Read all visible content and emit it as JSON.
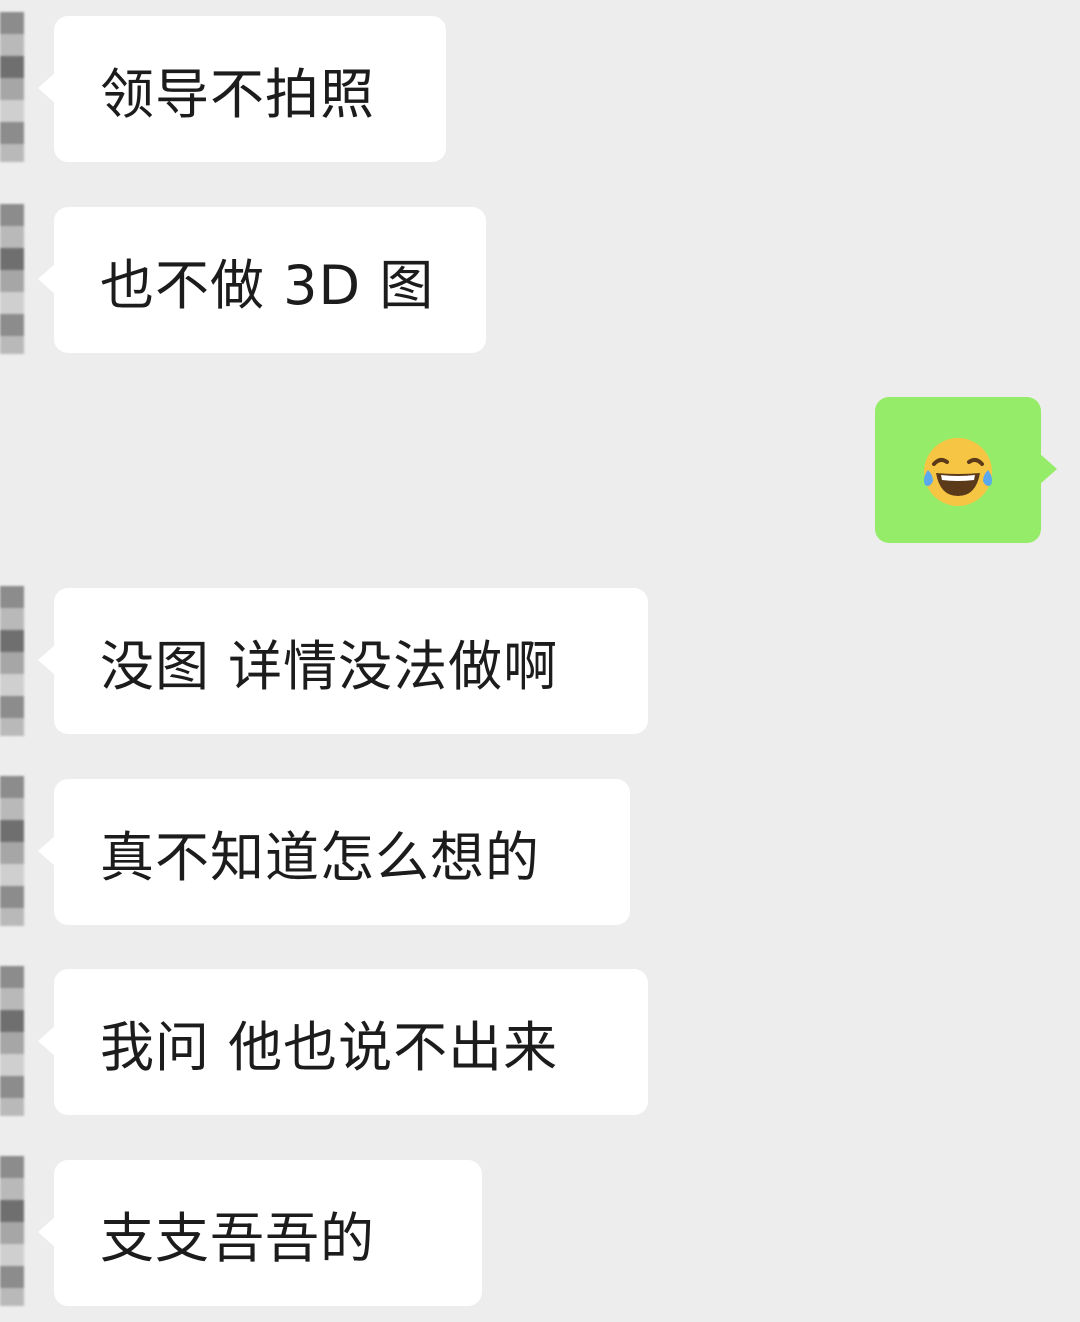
{
  "messages": [
    {
      "side": "left",
      "text": "领导不拍照"
    },
    {
      "side": "left",
      "text": "也不做 3D 图"
    },
    {
      "side": "right",
      "icon": "laughing-tears-emoji-icon"
    },
    {
      "side": "left",
      "text": "没图 详情没法做啊"
    },
    {
      "side": "left",
      "text": "真不知道怎么想的"
    },
    {
      "side": "left",
      "text": "我问 他也说不出来"
    },
    {
      "side": "left",
      "text": "支支吾吾的"
    }
  ],
  "colors": {
    "background": "#ededed",
    "incoming_bubble": "#ffffff",
    "outgoing_bubble": "#95ec69",
    "text": "#1c1c1c"
  }
}
